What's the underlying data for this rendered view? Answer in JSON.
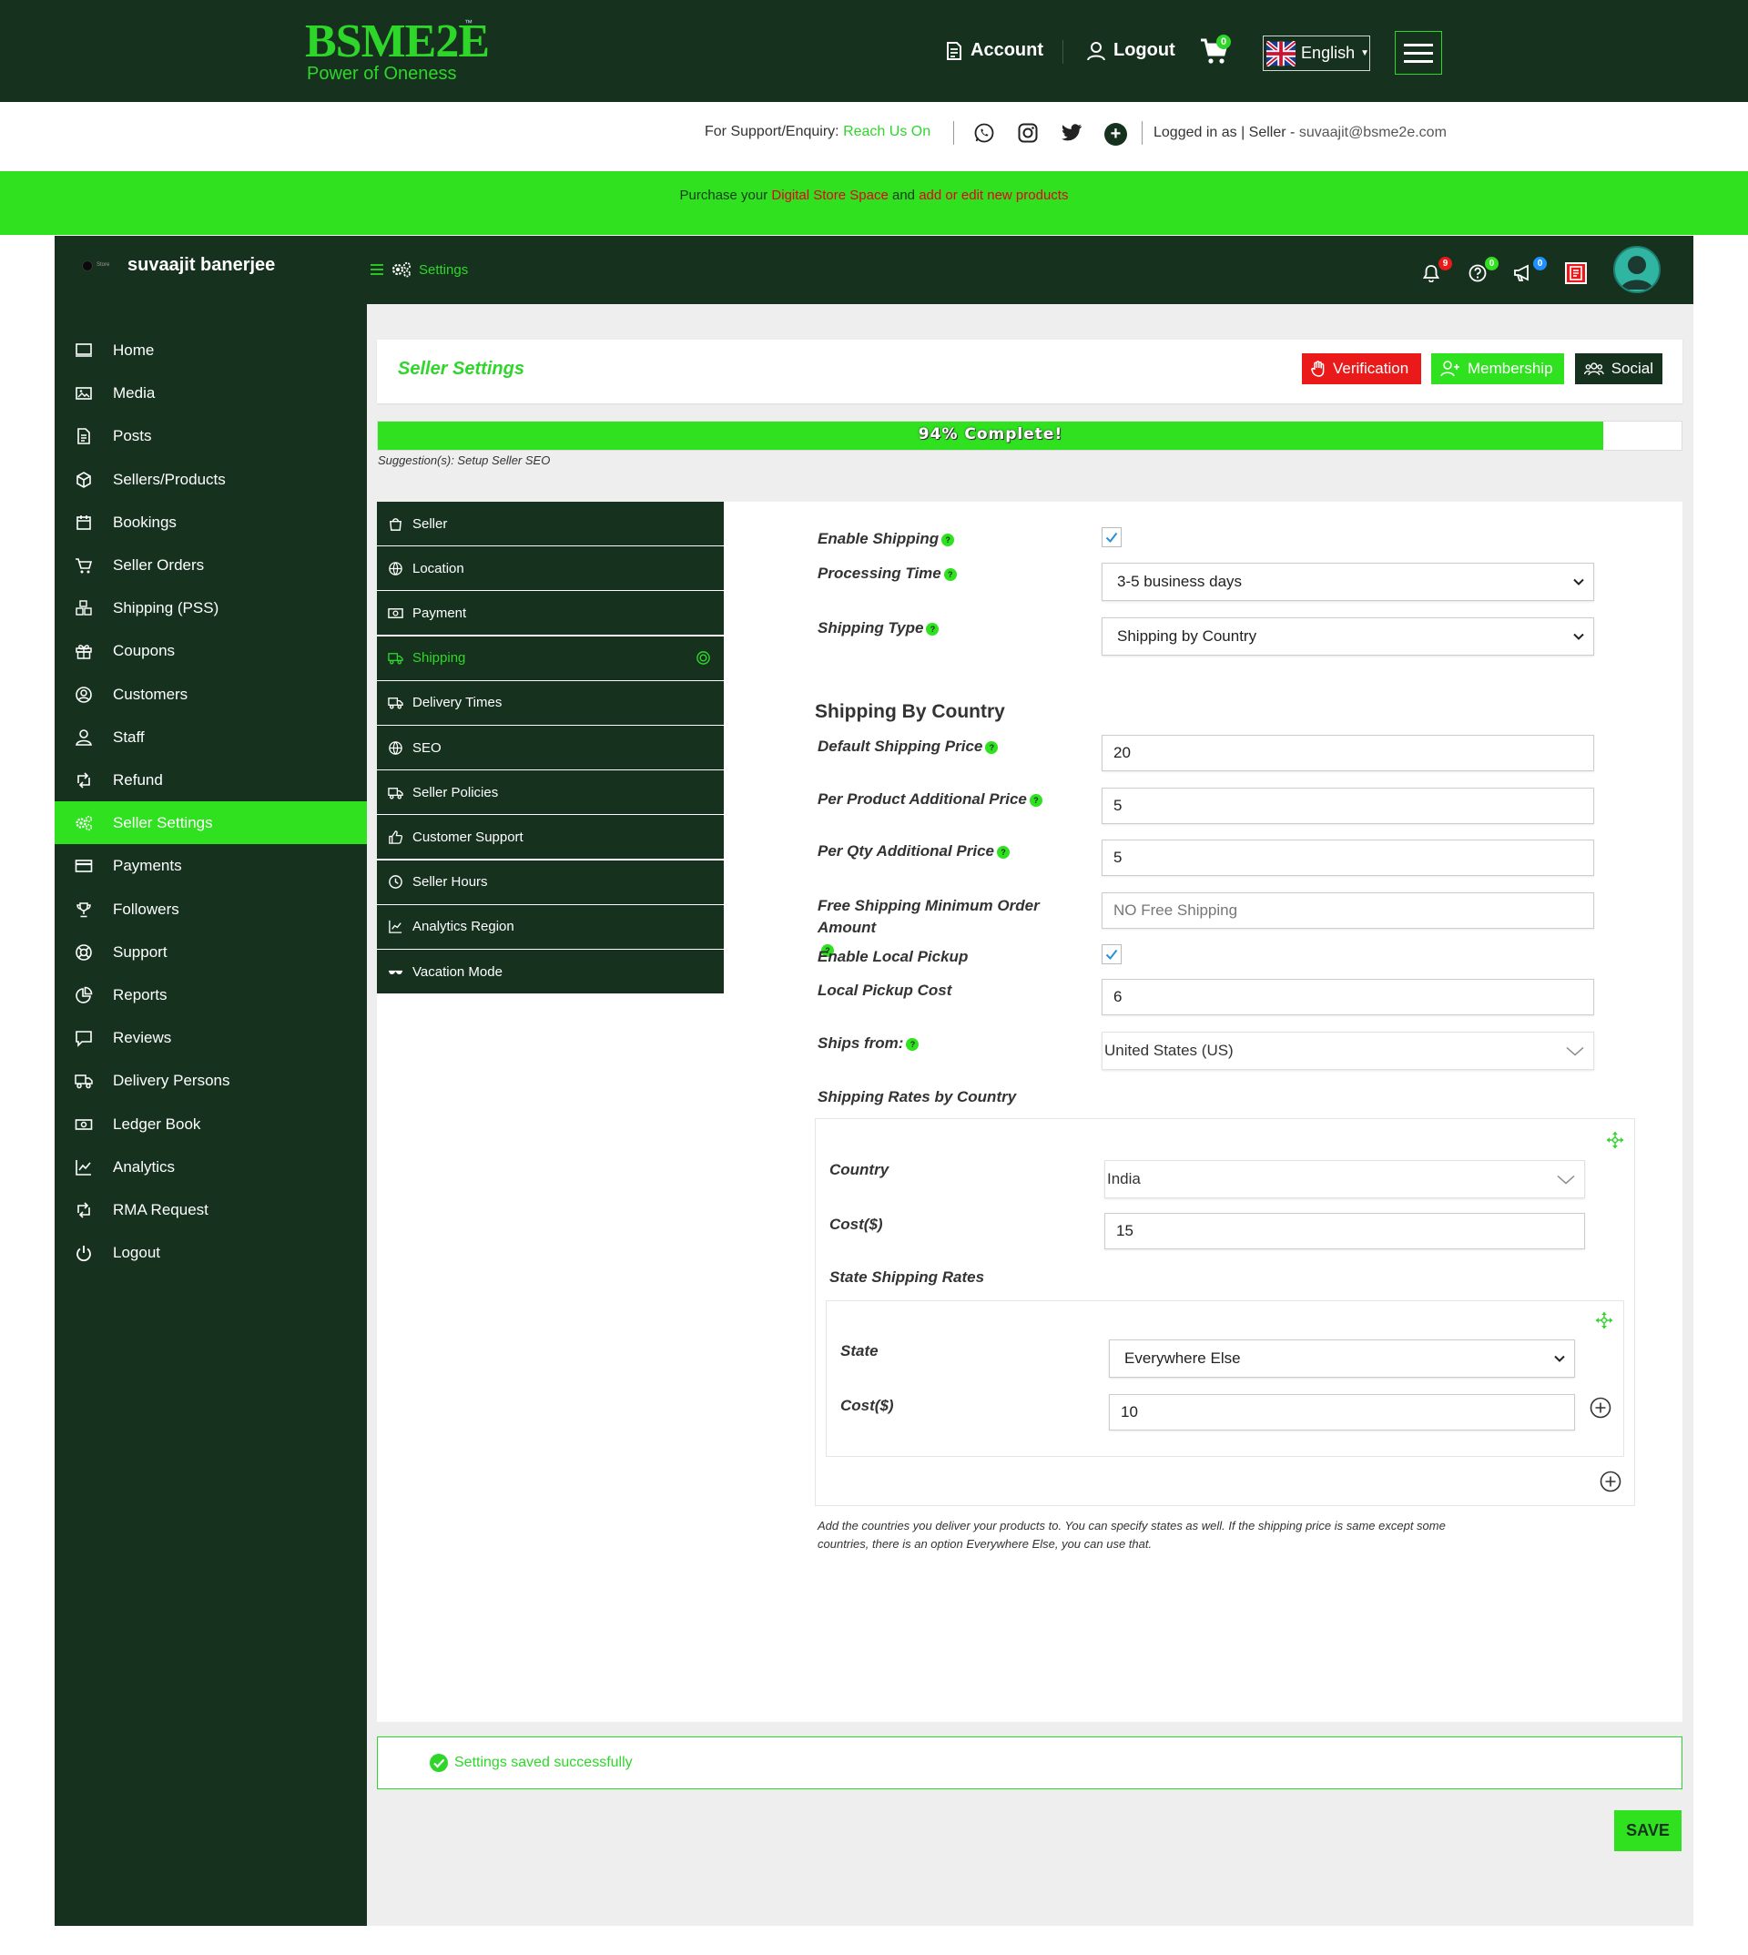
{
  "brand": {
    "name": "BSME2E",
    "tm": "™",
    "tagline": "Power of Oneness"
  },
  "topnav": {
    "account": "Account",
    "logout": "Logout",
    "cart_count": "0",
    "language": "English"
  },
  "support": {
    "prefix": "For Support/Enquiry:",
    "link": "Reach Us On",
    "logged_in_as": "Logged in as | Seller -",
    "email": "suvaajit@bsme2e.com"
  },
  "promo": {
    "t1": "Purchase your ",
    "link1": "Digital Store Space",
    "t2": " and ",
    "link2": "add or edit new products"
  },
  "dashboard": {
    "store_name": "suvaajit banerjee",
    "store_mini": "Store",
    "breadcrumb": "Settings",
    "badges": {
      "notifications": "9",
      "help": "0",
      "announcements": "0"
    }
  },
  "sidebar": {
    "items": [
      {
        "label": "Home",
        "icon": "monitor-icon"
      },
      {
        "label": "Media",
        "icon": "image-icon"
      },
      {
        "label": "Posts",
        "icon": "file-icon"
      },
      {
        "label": "Sellers/Products",
        "icon": "cube-icon"
      },
      {
        "label": "Bookings",
        "icon": "calendar-icon"
      },
      {
        "label": "Seller Orders",
        "icon": "cart-icon"
      },
      {
        "label": "Shipping (PSS)",
        "icon": "boxes-icon"
      },
      {
        "label": "Coupons",
        "icon": "gift-icon"
      },
      {
        "label": "Customers",
        "icon": "user-circle-icon"
      },
      {
        "label": "Staff",
        "icon": "user-icon"
      },
      {
        "label": "Refund",
        "icon": "retweet-icon"
      },
      {
        "label": "Seller Settings",
        "icon": "cogs-icon"
      },
      {
        "label": "Payments",
        "icon": "credit-card-icon"
      },
      {
        "label": "Followers",
        "icon": "trophy-icon"
      },
      {
        "label": "Support",
        "icon": "lifebuoy-icon"
      },
      {
        "label": "Reports",
        "icon": "pie-chart-icon"
      },
      {
        "label": "Reviews",
        "icon": "comment-icon"
      },
      {
        "label": "Delivery Persons",
        "icon": "truck-icon"
      },
      {
        "label": "Ledger Book",
        "icon": "money-icon"
      },
      {
        "label": "Analytics",
        "icon": "line-chart-icon"
      },
      {
        "label": "RMA Request",
        "icon": "retweet-icon"
      },
      {
        "label": "Logout",
        "icon": "power-icon"
      }
    ]
  },
  "main": {
    "title": "Seller Settings",
    "buttons": {
      "verification": "Verification",
      "membership": "Membership",
      "social": "Social"
    },
    "progress": {
      "percent": 94,
      "label": "94% Complete!"
    },
    "suggestion": "Suggestion(s): Setup Seller SEO"
  },
  "tabs": [
    {
      "label": "Seller"
    },
    {
      "label": "Location"
    },
    {
      "label": "Payment"
    },
    {
      "label": "Shipping"
    },
    {
      "label": "Delivery Times"
    },
    {
      "label": "SEO"
    },
    {
      "label": "Seller Policies"
    },
    {
      "label": "Customer Support"
    },
    {
      "label": "Seller Hours"
    },
    {
      "label": "Analytics Region"
    },
    {
      "label": "Vacation Mode"
    }
  ],
  "shipping": {
    "enable_shipping": "Enable Shipping",
    "processing_time_label": "Processing Time",
    "processing_time": "3-5 business days",
    "shipping_type_label": "Shipping Type",
    "shipping_type": "Shipping by Country",
    "section_title": "Shipping By Country",
    "default_price_label": "Default Shipping Price",
    "default_price": "20",
    "per_product_label": "Per Product Additional Price",
    "per_product": "5",
    "per_qty_label": "Per Qty Additional Price",
    "per_qty": "5",
    "free_min_label": "Free Shipping Minimum Order Amount",
    "free_min_placeholder": "NO Free Shipping",
    "local_pickup_label": "Enable Local Pickup",
    "local_pickup_cost_label": "Local Pickup Cost",
    "local_pickup_cost": "6",
    "ships_from_label": "Ships from:",
    "ships_from": "United States (US)",
    "rates_label": "Shipping Rates by Country",
    "country_label": "Country",
    "country": "India",
    "cost_label": "Cost($)",
    "country_cost": "15",
    "state_rates_label": "State Shipping Rates",
    "state_label": "State",
    "state": "Everywhere Else",
    "state_cost": "10",
    "note": "Add the countries you deliver your products to. You can specify states as well. If the shipping price is same except some countries, there is an option Everywhere Else, you can use that."
  },
  "success_message": "Settings saved successfully",
  "save_label": "SAVE",
  "colors": {
    "dark": "#16321f",
    "green": "#2fe11f",
    "red": "#ea1a1a"
  }
}
